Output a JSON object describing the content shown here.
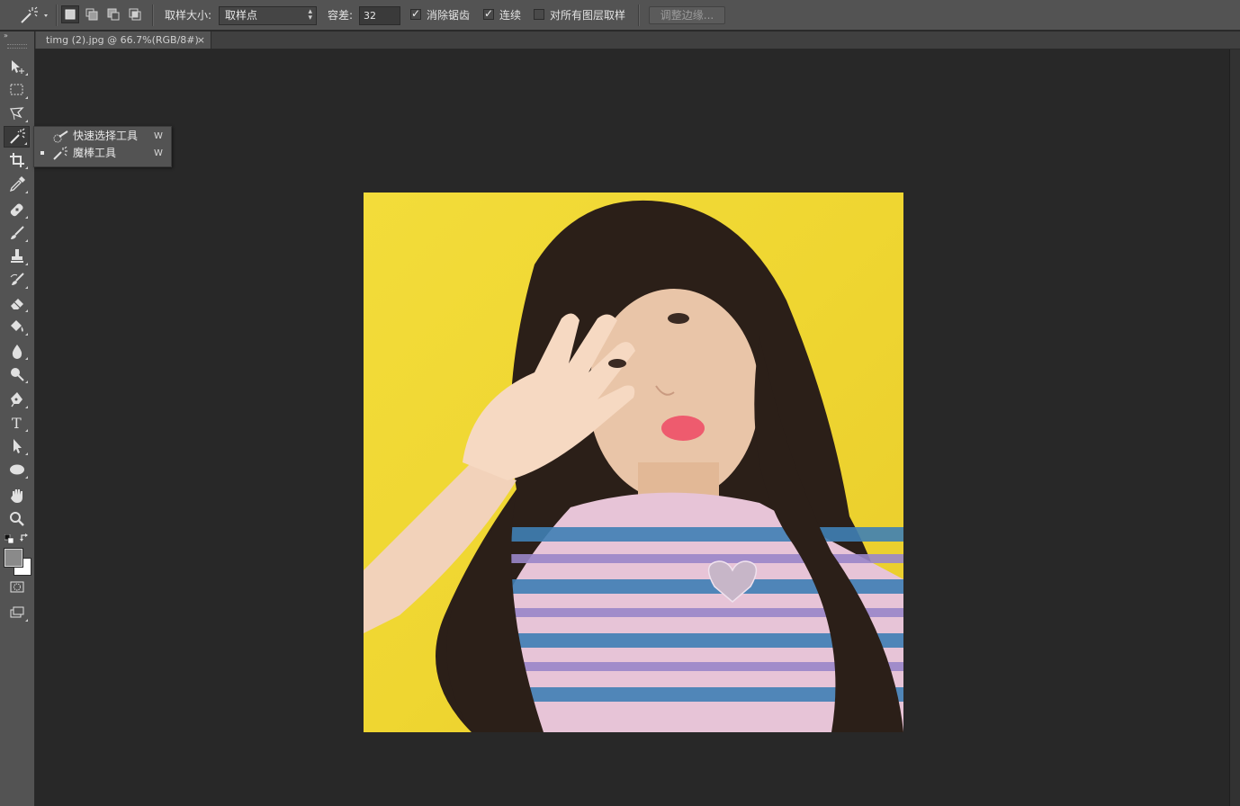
{
  "options_bar": {
    "sample_size_label": "取样大小:",
    "sample_size_value": "取样点",
    "tolerance_label": "容差:",
    "tolerance_value": "32",
    "anti_alias_label": "消除锯齿",
    "anti_alias_checked": true,
    "contiguous_label": "连续",
    "contiguous_checked": true,
    "sample_all_layers_label": "对所有图层取样",
    "sample_all_layers_checked": false,
    "refine_edge_label": "调整边缘..."
  },
  "document_tab": {
    "title": "timg (2).jpg @ 66.7%(RGB/8#)",
    "close_glyph": "×"
  },
  "tool_flyout": {
    "items": [
      {
        "label": "快速选择工具",
        "shortcut": "W",
        "icon": "quick-selection-icon",
        "selected": false
      },
      {
        "label": "魔棒工具",
        "shortcut": "W",
        "icon": "magic-wand-icon",
        "selected": true
      }
    ]
  },
  "tools": [
    "move-icon",
    "marquee-icon",
    "lasso-icon",
    "magic-wand-icon",
    "crop-icon",
    "eyedropper-icon",
    "healing-brush-icon",
    "brush-icon",
    "clone-stamp-icon",
    "history-brush-icon",
    "eraser-icon",
    "paint-bucket-icon",
    "blur-icon",
    "dodge-icon",
    "pen-icon",
    "type-icon",
    "path-selection-icon",
    "ellipse-icon",
    "hand-icon",
    "zoom-icon"
  ],
  "colors": {
    "foreground": "#8a8a8a",
    "background": "#ffffff",
    "image_backdrop": "#f2dd3a"
  }
}
